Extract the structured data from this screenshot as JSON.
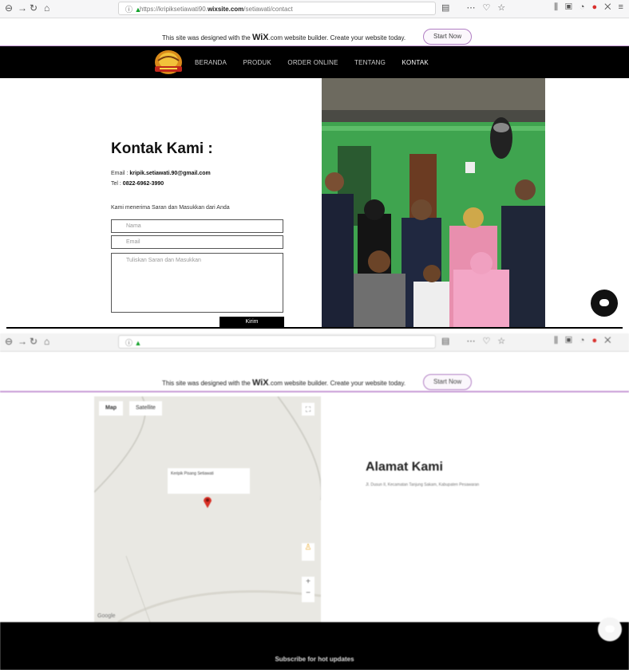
{
  "top": {
    "browser": {
      "url_prefix": "https://kripiksetiawati90.",
      "url_domain": "wixsite.com",
      "url_path": "/setiawati/contact"
    },
    "wix_banner": {
      "text_before": "This site was designed with the ",
      "brand": "WiX",
      "text_after": ".com website builder. Create your website today.",
      "button": "Start Now"
    },
    "nav": {
      "items": [
        "BERANDA",
        "PRODUK",
        "ORDER ONLINE",
        "TENTANG",
        "KONTAK"
      ],
      "active_index": 4
    },
    "contact": {
      "title": "Kontak Kami :",
      "email_label": "Email : ",
      "email": "kripik.setiawati.90@gmail.com",
      "tel_label": "Tel : ",
      "tel": "0822-6962-3990",
      "intro": "Kami menerima Saran dan Masukkan dari Anda",
      "name_placeholder": "Nama",
      "email_placeholder": "Email",
      "message_placeholder": "Tuliskan Saran dan Masukkan",
      "submit": "Kirim"
    }
  },
  "bottom": {
    "wix_banner": {
      "text_before": "This site was designed with the ",
      "brand": "WiX",
      "text_after": ".com website builder. Create your website today.",
      "button": "Start Now"
    },
    "map": {
      "tab_map": "Map",
      "tab_satellite": "Satellite",
      "place": "Keripik Pisang Setiawati",
      "google": "Google"
    },
    "address": {
      "title": "Alamat Kami",
      "text": "Jl. Dusun II, Kecamatan Tanjung Sakam, Kabupaten Pesawaran"
    },
    "footer": {
      "subscribe": "Subscribe for hot updates"
    }
  },
  "colors": {
    "wix_accent": "#c79ad6",
    "nav_bg": "#000000",
    "wall_green": "#3fa44f"
  }
}
